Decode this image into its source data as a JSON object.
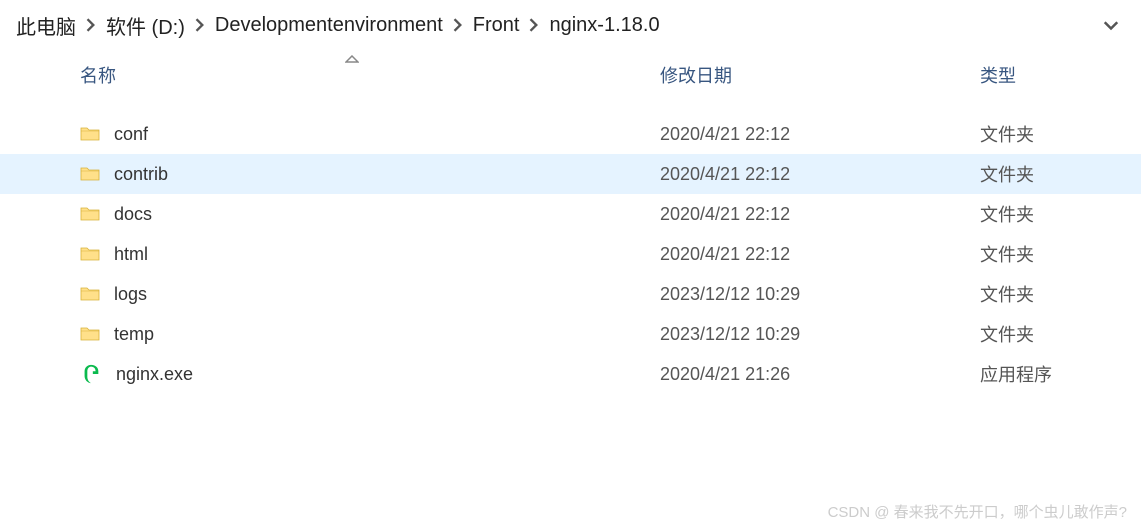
{
  "breadcrumb": {
    "items": [
      {
        "label": "此电脑"
      },
      {
        "label": "软件 (D:)"
      },
      {
        "label": "Developmentenvironment"
      },
      {
        "label": "Front"
      },
      {
        "label": "nginx-1.18.0"
      }
    ]
  },
  "columns": {
    "name": "名称",
    "date": "修改日期",
    "type": "类型"
  },
  "files": [
    {
      "name": "conf",
      "date": "2020/4/21 22:12",
      "type": "文件夹",
      "icon": "folder"
    },
    {
      "name": "contrib",
      "date": "2020/4/21 22:12",
      "type": "文件夹",
      "icon": "folder",
      "hovered": true
    },
    {
      "name": "docs",
      "date": "2020/4/21 22:12",
      "type": "文件夹",
      "icon": "folder"
    },
    {
      "name": "html",
      "date": "2020/4/21 22:12",
      "type": "文件夹",
      "icon": "folder"
    },
    {
      "name": "logs",
      "date": "2023/12/12 10:29",
      "type": "文件夹",
      "icon": "folder"
    },
    {
      "name": "temp",
      "date": "2023/12/12 10:29",
      "type": "文件夹",
      "icon": "folder"
    },
    {
      "name": "nginx.exe",
      "date": "2020/4/21 21:26",
      "type": "应用程序",
      "icon": "exe"
    }
  ],
  "watermark": "CSDN @ 春来我不先开口，哪个虫儿敢作声?"
}
